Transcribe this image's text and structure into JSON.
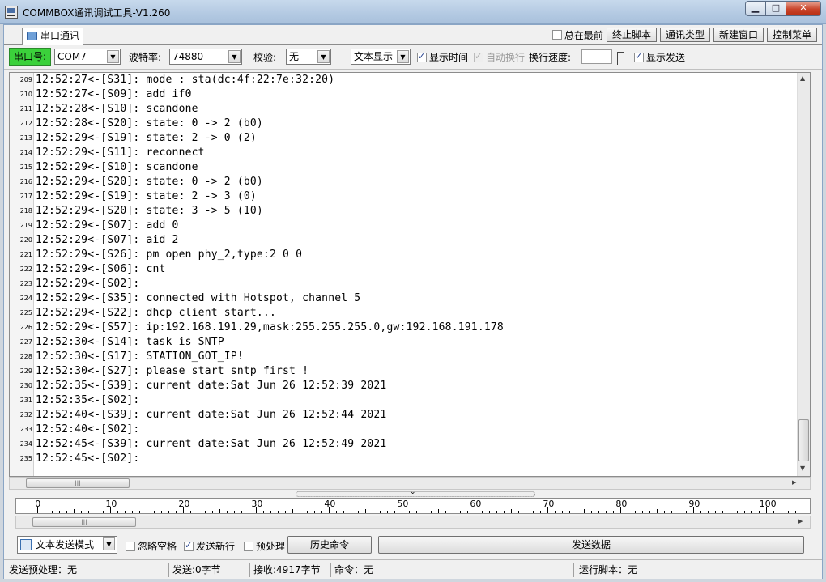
{
  "window": {
    "title": "COMMBOX通讯调试工具-V1.260"
  },
  "tabs": {
    "serial_label": "串口通讯"
  },
  "topbar": {
    "always_on_top": "总在最前",
    "stop_script": "终止脚本",
    "comm_type": "通讯类型",
    "new_window": "新建窗口",
    "control_menu": "控制菜单"
  },
  "toolbar": {
    "port_label": "串口号:",
    "port_value": "COM7",
    "baud_label": "波特率:",
    "baud_value": "74880",
    "parity_label": "校验:",
    "parity_value": "无",
    "display_mode": "文本显示",
    "show_time": "显示时间",
    "auto_wrap": "自动换行",
    "wrap_speed_label": "换行速度:",
    "show_send": "显示发送"
  },
  "log": [
    {
      "n": "209",
      "t": "12:52:27<-[S31]: mode : sta(dc:4f:22:7e:32:20)"
    },
    {
      "n": "210",
      "t": "12:52:27<-[S09]: add if0"
    },
    {
      "n": "211",
      "t": "12:52:28<-[S10]: scandone"
    },
    {
      "n": "212",
      "t": "12:52:28<-[S20]: state: 0 -> 2 (b0)"
    },
    {
      "n": "213",
      "t": "12:52:29<-[S19]: state: 2 -> 0 (2)"
    },
    {
      "n": "214",
      "t": "12:52:29<-[S11]: reconnect"
    },
    {
      "n": "215",
      "t": "12:52:29<-[S10]: scandone"
    },
    {
      "n": "216",
      "t": "12:52:29<-[S20]: state: 0 -> 2 (b0)"
    },
    {
      "n": "217",
      "t": "12:52:29<-[S19]: state: 2 -> 3 (0)"
    },
    {
      "n": "218",
      "t": "12:52:29<-[S20]: state: 3 -> 5 (10)"
    },
    {
      "n": "219",
      "t": "12:52:29<-[S07]: add 0"
    },
    {
      "n": "220",
      "t": "12:52:29<-[S07]: aid 2"
    },
    {
      "n": "221",
      "t": "12:52:29<-[S26]: pm open phy_2,type:2 0 0"
    },
    {
      "n": "222",
      "t": "12:52:29<-[S06]: cnt"
    },
    {
      "n": "223",
      "t": "12:52:29<-[S02]:"
    },
    {
      "n": "224",
      "t": "12:52:29<-[S35]: connected with Hotspot, channel 5"
    },
    {
      "n": "225",
      "t": "12:52:29<-[S22]: dhcp client start..."
    },
    {
      "n": "226",
      "t": "12:52:29<-[S57]: ip:192.168.191.29,mask:255.255.255.0,gw:192.168.191.178"
    },
    {
      "n": "227",
      "t": "12:52:30<-[S14]: task is SNTP"
    },
    {
      "n": "228",
      "t": "12:52:30<-[S17]: STATION_GOT_IP!"
    },
    {
      "n": "229",
      "t": "12:52:30<-[S27]: please start sntp first !"
    },
    {
      "n": "230",
      "t": "12:52:35<-[S39]: current date:Sat Jun 26 12:52:39 2021"
    },
    {
      "n": "231",
      "t": "12:52:35<-[S02]:"
    },
    {
      "n": "232",
      "t": "12:52:40<-[S39]: current date:Sat Jun 26 12:52:44 2021"
    },
    {
      "n": "233",
      "t": "12:52:40<-[S02]:"
    },
    {
      "n": "234",
      "t": "12:52:45<-[S39]: current date:Sat Jun 26 12:52:49 2021"
    },
    {
      "n": "235",
      "t": "12:52:45<-[S02]:"
    }
  ],
  "ruler": {
    "labels": [
      "0",
      "10",
      "20",
      "30",
      "40",
      "50",
      "60",
      "70",
      "80",
      "90",
      "100"
    ]
  },
  "sendbar": {
    "mode": "文本发送模式",
    "ignore_space": "忽略空格",
    "send_newline": "发送新行",
    "preprocess": "预处理",
    "history": "历史命令",
    "send_data": "发送数据"
  },
  "status": {
    "preprocess": "发送预处理：无",
    "sent": "发送:0字节",
    "received": "接收:4917字节",
    "command": "命令：无",
    "script": "运行脚本：无"
  }
}
